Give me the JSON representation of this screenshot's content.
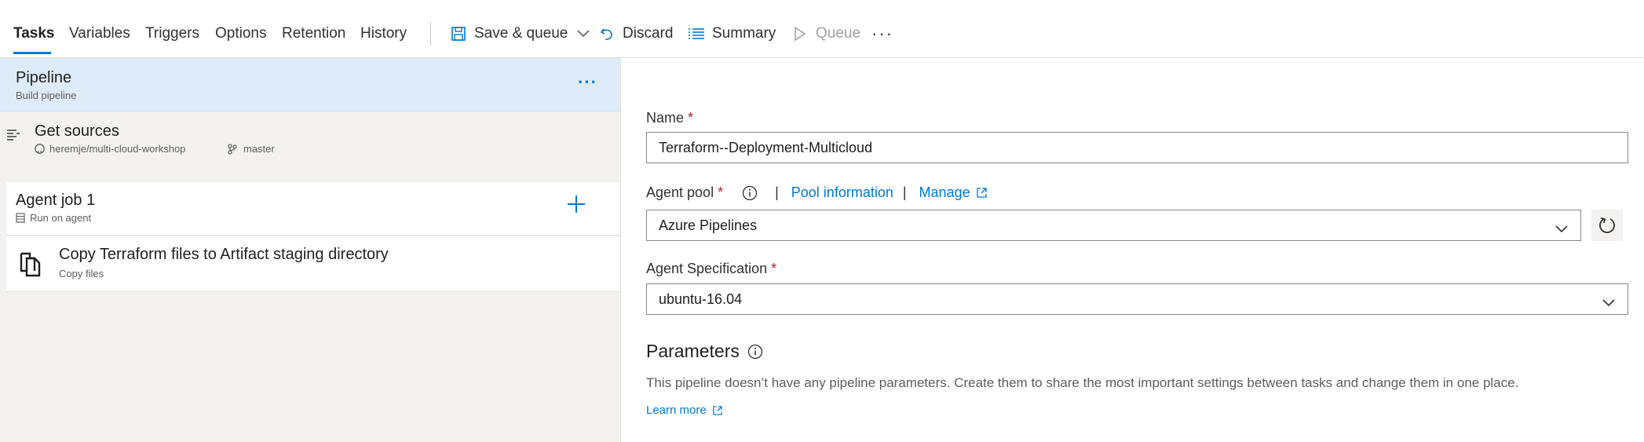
{
  "tabs": [
    {
      "label": "Tasks"
    },
    {
      "label": "Variables"
    },
    {
      "label": "Triggers"
    },
    {
      "label": "Options"
    },
    {
      "label": "Retention"
    },
    {
      "label": "History"
    }
  ],
  "toolbar": {
    "save_queue": "Save & queue",
    "discard": "Discard",
    "summary": "Summary",
    "queue": "Queue"
  },
  "pipeline": {
    "title": "Pipeline",
    "subtitle": "Build pipeline"
  },
  "get_sources": {
    "title": "Get sources",
    "repo": "heremje/multi-cloud-workshop",
    "branch": "master"
  },
  "agent_job": {
    "title": "Agent job 1",
    "subtitle": "Run on agent"
  },
  "task": {
    "title": "Copy Terraform files to Artifact staging directory",
    "subtitle": "Copy files"
  },
  "form": {
    "name_label": "Name",
    "name_value": "Terraform--Deployment-Multicloud",
    "agent_pool_label": "Agent pool",
    "pool_information": "Pool information",
    "manage": "Manage",
    "agent_pool_value": "Azure Pipelines",
    "agent_spec_label": "Agent Specification",
    "agent_spec_value": "ubuntu-16.04",
    "required_mark": "*"
  },
  "parameters": {
    "title": "Parameters",
    "description": "This pipeline doesn’t have any pipeline parameters. Create them to share the most important settings between tasks and change them in one place.",
    "learn_more": "Learn more"
  },
  "colors": {
    "accent": "#0078d4",
    "required": "#a4262c",
    "selected_bg": "#deecf9",
    "panel_bg": "#f3f2f1"
  }
}
